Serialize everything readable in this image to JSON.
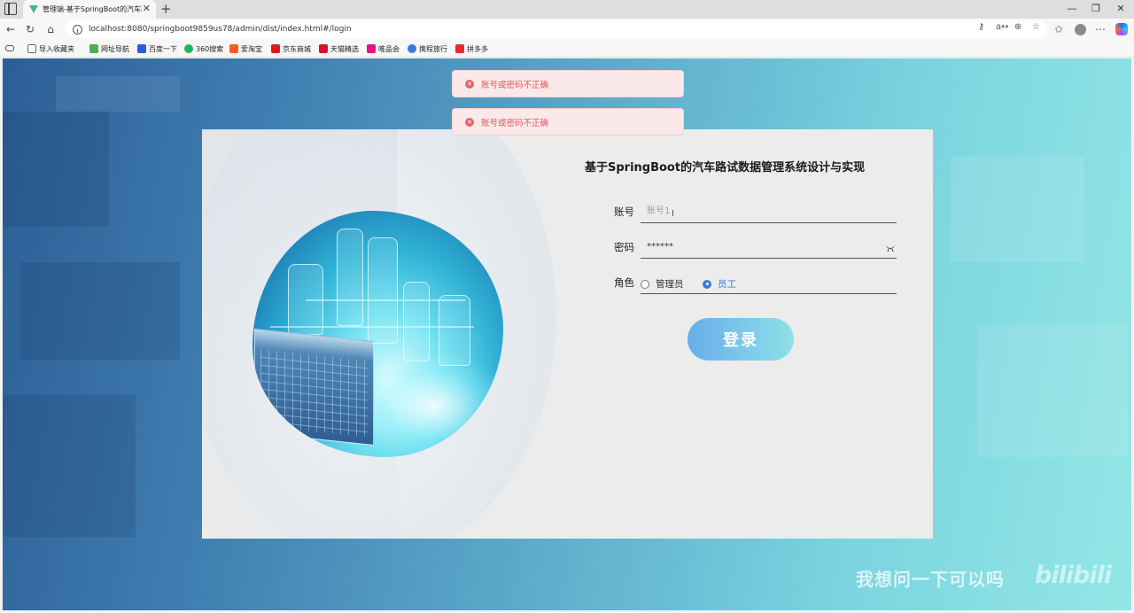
{
  "browser": {
    "tab_title": "管理端-基于SpringBoot的汽车路",
    "new_tab_symbol": "+",
    "url": "localhost:8080/springboot9859us78/admin/dist/index.html#/login",
    "bookmarks": [
      {
        "label": "导入收藏夹",
        "icon": "folder-icon",
        "color": "#6b6b6b"
      },
      {
        "label": "网址导航",
        "icon": "nav-icon",
        "color": "#4caf50"
      },
      {
        "label": "百度一下",
        "icon": "baidu-icon",
        "color": "#2f5bd8"
      },
      {
        "label": "360搜索",
        "icon": "360-icon",
        "color": "#19b955"
      },
      {
        "label": "爱淘宝",
        "icon": "taobao-icon",
        "color": "#ff5a1f"
      },
      {
        "label": "京东商城",
        "icon": "jd-icon",
        "color": "#d71c1c"
      },
      {
        "label": "天猫精选",
        "icon": "tmall-icon",
        "color": "#d3152b"
      },
      {
        "label": "唯品会",
        "icon": "vip-icon",
        "color": "#e0167e"
      },
      {
        "label": "携程旅行",
        "icon": "ctrip-icon",
        "color": "#2f7ee8"
      },
      {
        "label": "拼多多",
        "icon": "pdd-icon",
        "color": "#e52b2b"
      }
    ]
  },
  "toasts": [
    {
      "message": "账号或密码不正确",
      "icon": "error-circle-icon"
    },
    {
      "message": "账号或密码不正确",
      "icon": "error-circle-icon"
    }
  ],
  "login": {
    "title": "基于SpringBoot的汽车路试数据管理系统设计与实现",
    "account_label": "账号",
    "account_placeholder": "账号1",
    "password_label": "密码",
    "password_value": "******",
    "role_label": "角色",
    "roles": [
      {
        "label": "管理员",
        "checked": false
      },
      {
        "label": "员工",
        "checked": true
      }
    ],
    "submit_label": "登录"
  },
  "overlay": {
    "caption": "我想问一下可以吗",
    "logo_text": "bilibili"
  },
  "colors": {
    "accent": "#3a7be0",
    "error": "#e2545c",
    "button_start": "#67aee8",
    "button_end": "#8ee0e8"
  }
}
